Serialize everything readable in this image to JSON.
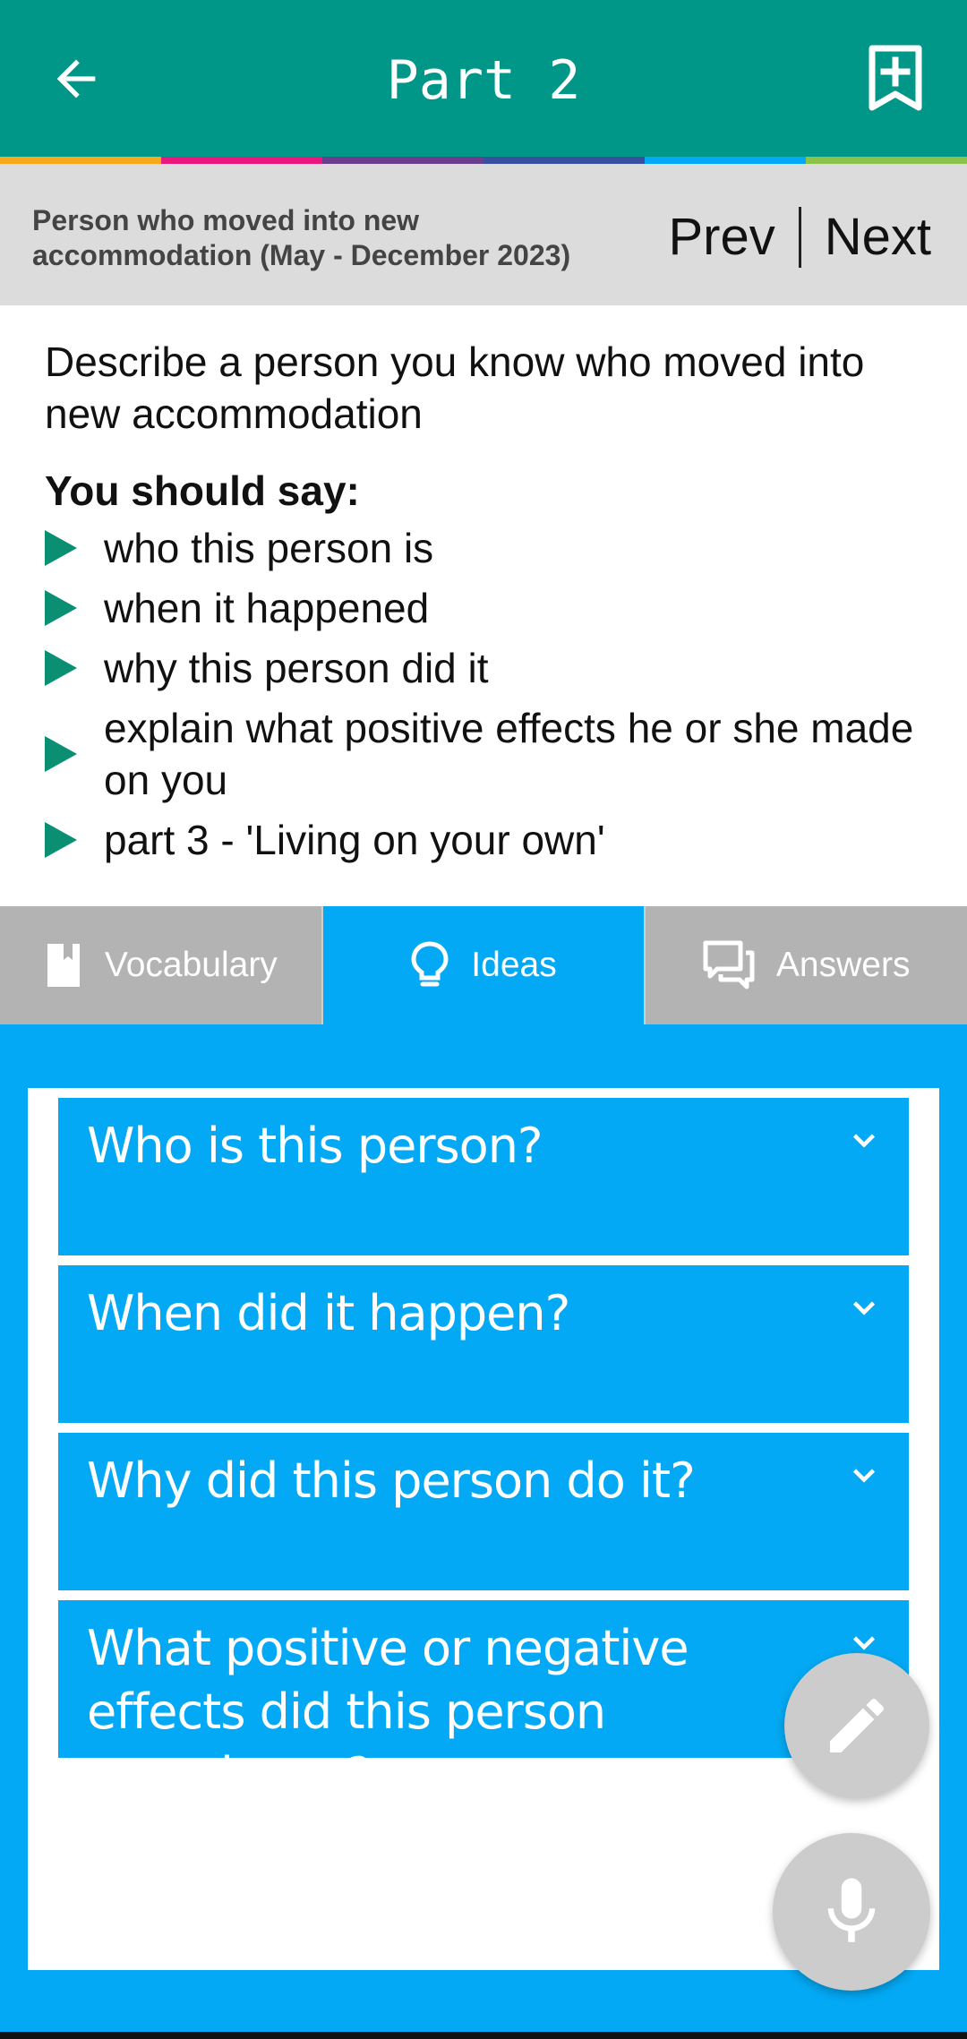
{
  "appbar": {
    "title": "Part 2",
    "back_icon": "arrow-left-icon",
    "bookmark_icon": "bookmark-add-icon",
    "color": "#009688"
  },
  "stripe_colors": [
    "#f7a81b",
    "#e8187c",
    "#6a3d8e",
    "#3a4ea0",
    "#03a9f4",
    "#8bc34a"
  ],
  "subheader": {
    "topic": "Person who moved into new accommodation (May - December 2023)",
    "prev": "Prev",
    "next": "Next"
  },
  "prompt": {
    "description": "Describe a person you know who moved into new accommodation",
    "you_should_say": "You should say:",
    "cues": [
      "who this person is",
      "when it happened",
      "why this person did it",
      "explain what positive effects he or she made on you",
      "part 3 - 'Living on your own'"
    ]
  },
  "tabs": [
    {
      "label": "Vocabulary",
      "icon": "book-icon",
      "active": false
    },
    {
      "label": "Ideas",
      "icon": "lightbulb-icon",
      "active": true
    },
    {
      "label": "Answers",
      "icon": "chat-bubbles-icon",
      "active": false
    }
  ],
  "ideas": [
    "Who is this person?",
    "When did it happen?",
    "Why did this person do it?",
    "What positive or negative effects did this person experience?"
  ],
  "fabs": {
    "edit_icon": "pencil-icon",
    "mic_icon": "microphone-icon"
  },
  "colors": {
    "accent": "#03a9f4",
    "bullet": "#0a8f73",
    "tab_inactive": "#b3b3b3"
  }
}
